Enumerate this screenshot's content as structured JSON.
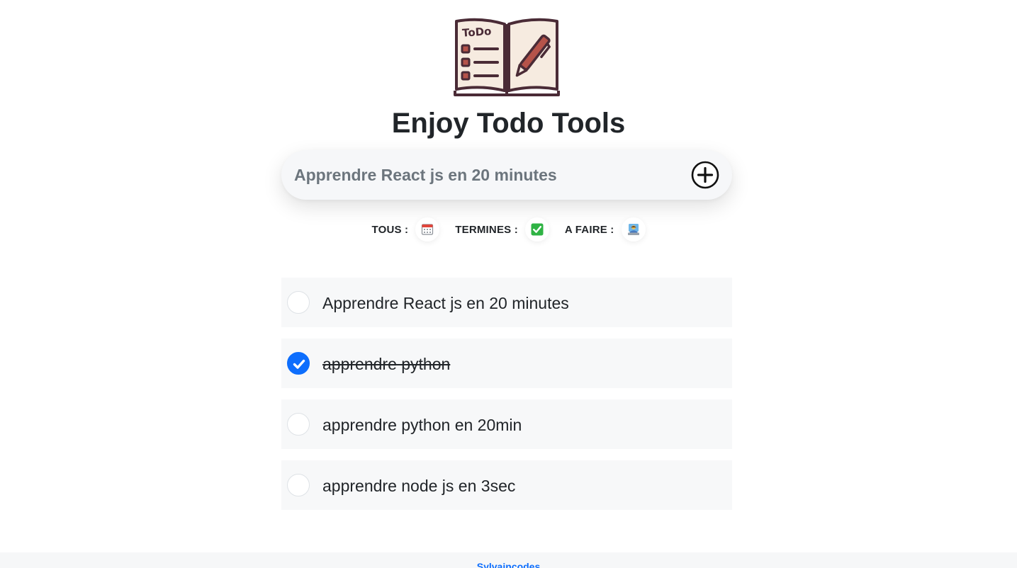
{
  "app": {
    "title": "Enjoy Todo Tools",
    "logo_icon": "todo-book-icon",
    "logo_text": "ToDo"
  },
  "add_form": {
    "input_value": "Apprendre React js en 20 minutes",
    "button_icon": "plus-circle-icon"
  },
  "filters": [
    {
      "label": "TOUS :",
      "icon": "calendar-icon"
    },
    {
      "label": "TERMINES :",
      "icon": "check-mark-icon"
    },
    {
      "label": "A FAIRE :",
      "icon": "person-at-laptop-icon"
    }
  ],
  "todos": [
    {
      "text": "Apprendre React js en 20 minutes",
      "done": false
    },
    {
      "text": "apprendre python",
      "done": true
    },
    {
      "text": "apprendre python en 20min",
      "done": false
    },
    {
      "text": "apprendre node js en 3sec",
      "done": false
    }
  ],
  "footer": {
    "link_text": "Sylvaincodes"
  },
  "colors": {
    "accent": "#0d6efd",
    "logo_stroke": "#4a2b36",
    "logo_fill": "#f6ebe0",
    "logo_accent": "#b5534a"
  }
}
